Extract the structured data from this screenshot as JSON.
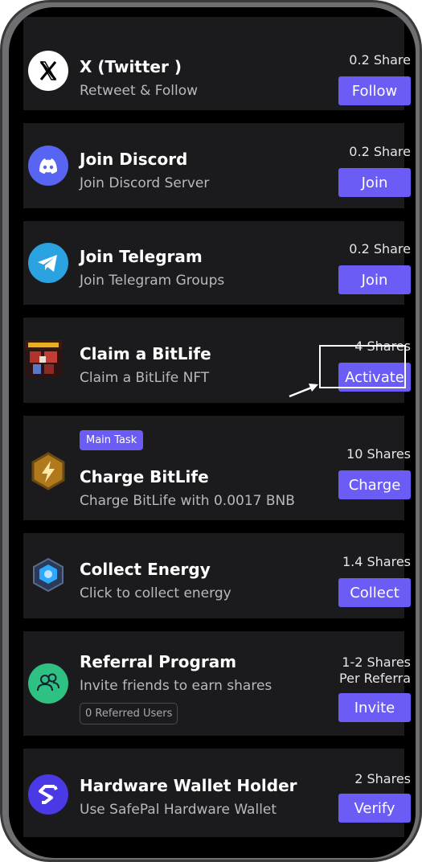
{
  "tasks": [
    {
      "title": "X (Twitter )",
      "subtitle": "Retweet & Follow",
      "shares": "0.2 Share",
      "button": "Follow",
      "icon": "x-twitter-icon"
    },
    {
      "title": "Join Discord",
      "subtitle": "Join Discord Server",
      "shares": "0.2 Share",
      "button": "Join",
      "icon": "discord-icon"
    },
    {
      "title": "Join Telegram",
      "subtitle": "Join Telegram Groups",
      "shares": "0.2 Share",
      "button": "Join",
      "icon": "telegram-icon"
    },
    {
      "title": "Claim a BitLife",
      "subtitle": "Claim a BitLife NFT",
      "shares": "4 Shares",
      "button": "Activate",
      "icon": "bitlife-nft-icon"
    },
    {
      "badge": "Main Task",
      "title": "Charge BitLife",
      "subtitle": "Charge BitLife with 0.0017 BNB",
      "shares": "10 Shares",
      "button": "Charge",
      "icon": "lightning-hexagon-icon"
    },
    {
      "title": "Collect Energy",
      "subtitle": "Click to collect energy",
      "shares": "1.4 Shares",
      "button": "Collect",
      "icon": "energy-cube-icon"
    },
    {
      "title": "Referral Program",
      "subtitle": "Invite friends to earn shares",
      "shares_line1": "1-2 Shares",
      "shares_line2": "Per Referra",
      "referred": "0 Referred Users",
      "button": "Invite",
      "icon": "users-icon"
    },
    {
      "title": "Hardware Wallet Holder",
      "subtitle": "Use SafePal Hardware Wallet",
      "shares": "2 Shares",
      "button": "Verify",
      "icon": "safepal-icon"
    }
  ],
  "colors": {
    "accent": "#6b5cf6",
    "card": "#1b1b1d",
    "background": "#000000"
  }
}
